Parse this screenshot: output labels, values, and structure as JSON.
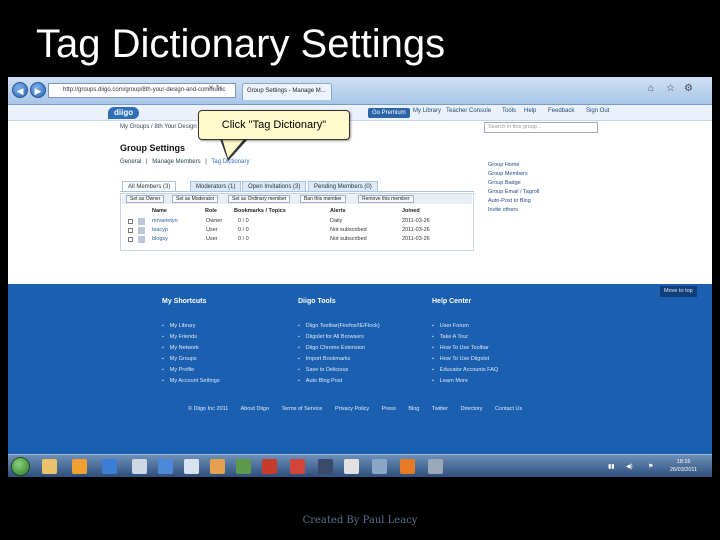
{
  "slide": {
    "title": "Tag Dictionary Settings",
    "credit": "Created By Paul Leacy"
  },
  "browser": {
    "url": "http://groups.diigo.com/group/8th-your-design-and-communic",
    "tabs": [
      "Group Settings - Manage M..."
    ],
    "back_label": "◀",
    "forward_label": "▶"
  },
  "diigo": {
    "logo": "diigo",
    "nav": [
      "Go Premium",
      "My Library",
      "Teacher Console",
      "Tools",
      "Help",
      "Feedback",
      "Sign Out"
    ],
    "breadcrumb": "My Groups / 8th Your Design ...",
    "search_placeholder": "Search in this group..."
  },
  "callout": {
    "text": "Click \"Tag Dictionary\""
  },
  "group_settings": {
    "title": "Group Settings",
    "links": [
      "General",
      "|",
      "Manage Members",
      "|",
      "Tag Dictionary"
    ],
    "tabs": [
      "All Members (3)",
      "Moderators (1)",
      "Open Invitations (3)",
      "Pending Members (0)"
    ],
    "actions": [
      "Set as Owner",
      "Set as Moderator",
      "Set as Ordinary member",
      "Ban this member",
      "Remove this member"
    ],
    "columns": [
      "Name",
      "Role",
      "Bookmarks / Topics",
      "Alerts",
      "Joined"
    ],
    "members": [
      {
        "name": "mrvarietyo",
        "role": "Owner",
        "bookmarks": "0 / 0",
        "alerts": "Daily",
        "joined": "2011-03-26"
      },
      {
        "name": "leacyp",
        "role": "User",
        "bookmarks": "0 / 0",
        "alerts": "Not subscribed",
        "joined": "2011-03-26"
      },
      {
        "name": "blogsy",
        "role": "User",
        "bookmarks": "0 / 0",
        "alerts": "Not subscribed",
        "joined": "2011-03-26"
      }
    ],
    "side_links": [
      "Group Home",
      "Group Members",
      "Group Badge",
      "Group Email / Tagroll",
      "Auto-Post to Blog",
      "Invite others"
    ]
  },
  "footer": {
    "move_top": "Move to top",
    "columns": [
      {
        "title": "My Shortcuts",
        "items": [
          "My Library",
          "My Friends",
          "My Network",
          "My Groups",
          "My Profile",
          "My Account Settings"
        ]
      },
      {
        "title": "Diigo Tools",
        "items": [
          "Diigo Toolbar(Firefox/IE/Flock)",
          "Diigolet for All Browsers",
          "Diigo Chrome Extension",
          "Import Bookmarks",
          "Save to Delicious",
          "Auto Blog Post"
        ]
      },
      {
        "title": "Help Center",
        "items": [
          "User Forum",
          "Take A Tour",
          "How To Use Toolbar",
          "How To Use Diigolet",
          "Educator Accounts FAQ",
          "Learn More"
        ]
      }
    ],
    "bottom_links": [
      "© Diigo Inc 2011",
      "About Diigo",
      "Terms of Service",
      "Privacy Policy",
      "Press",
      "Blog",
      "Twitter",
      "Directory",
      "Contact Us"
    ]
  },
  "taskbar": {
    "time": "18:16",
    "date": "26/03/2011"
  },
  "colors": {
    "slide_bg": "#000000",
    "footer_blue": "#1a5fb0",
    "callout_yellow": "#fffbcc",
    "diigo_blue": "#2f6eb7"
  }
}
